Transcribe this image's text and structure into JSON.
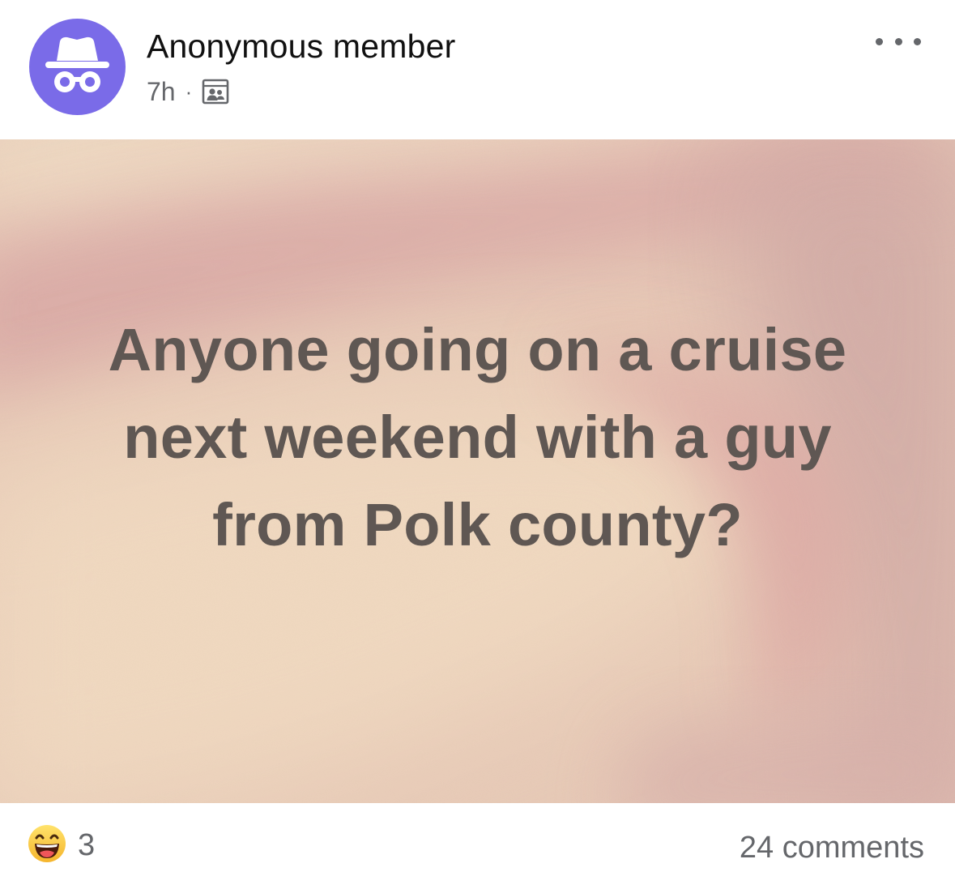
{
  "post": {
    "author": "Anonymous member",
    "time": "7h",
    "separator": "·",
    "audience_icon": "group-members-icon",
    "more_icon": "more-options-icon",
    "text": "Anyone going on a cruise next weekend with a guy from Polk county?",
    "avatar_icon": "anonymous-incognito-icon",
    "colors": {
      "avatar_bg": "#7a6be8",
      "text": "#5f5753",
      "meta": "#65676b"
    }
  },
  "footer": {
    "reaction_icon": "haha-emoji-icon",
    "reaction_count": "3",
    "comments": "24 comments"
  }
}
